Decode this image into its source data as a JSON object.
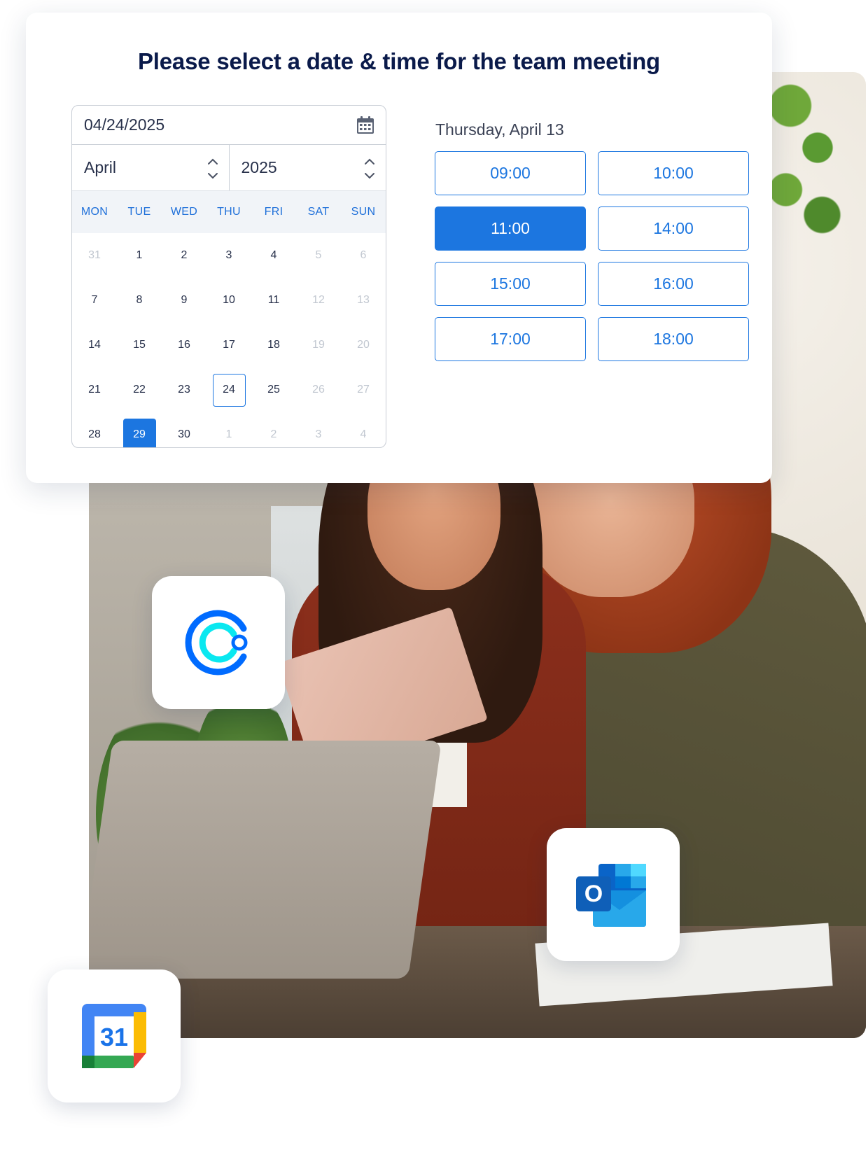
{
  "card": {
    "title": "Please select a date & time for the team meeting"
  },
  "picker": {
    "date_value": "04/24/2025",
    "month": "April",
    "year": "2025",
    "weekdays": [
      "MON",
      "TUE",
      "WED",
      "THU",
      "FRI",
      "SAT",
      "SUN"
    ],
    "days": [
      {
        "label": "31",
        "state": "muted"
      },
      {
        "label": "1",
        "state": "normal"
      },
      {
        "label": "2",
        "state": "normal"
      },
      {
        "label": "3",
        "state": "normal"
      },
      {
        "label": "4",
        "state": "normal"
      },
      {
        "label": "5",
        "state": "muted"
      },
      {
        "label": "6",
        "state": "muted"
      },
      {
        "label": "7",
        "state": "normal"
      },
      {
        "label": "8",
        "state": "normal"
      },
      {
        "label": "9",
        "state": "normal"
      },
      {
        "label": "10",
        "state": "normal"
      },
      {
        "label": "11",
        "state": "normal"
      },
      {
        "label": "12",
        "state": "muted"
      },
      {
        "label": "13",
        "state": "muted"
      },
      {
        "label": "14",
        "state": "normal"
      },
      {
        "label": "15",
        "state": "normal"
      },
      {
        "label": "16",
        "state": "normal"
      },
      {
        "label": "17",
        "state": "normal"
      },
      {
        "label": "18",
        "state": "normal"
      },
      {
        "label": "19",
        "state": "muted"
      },
      {
        "label": "20",
        "state": "muted"
      },
      {
        "label": "21",
        "state": "normal"
      },
      {
        "label": "22",
        "state": "normal"
      },
      {
        "label": "23",
        "state": "normal"
      },
      {
        "label": "24",
        "state": "today"
      },
      {
        "label": "25",
        "state": "normal"
      },
      {
        "label": "26",
        "state": "muted"
      },
      {
        "label": "27",
        "state": "muted"
      },
      {
        "label": "28",
        "state": "normal"
      },
      {
        "label": "29",
        "state": "selected"
      },
      {
        "label": "30",
        "state": "normal"
      },
      {
        "label": "1",
        "state": "muted"
      },
      {
        "label": "2",
        "state": "muted"
      },
      {
        "label": "3",
        "state": "muted"
      },
      {
        "label": "4",
        "state": "muted"
      }
    ]
  },
  "slots": {
    "date_label": "Thursday, April 13",
    "times": [
      {
        "label": "09:00",
        "active": false
      },
      {
        "label": "10:00",
        "active": false
      },
      {
        "label": "11:00",
        "active": true
      },
      {
        "label": "14:00",
        "active": false
      },
      {
        "label": "15:00",
        "active": false
      },
      {
        "label": "16:00",
        "active": false
      },
      {
        "label": "17:00",
        "active": false
      },
      {
        "label": "18:00",
        "active": false
      }
    ]
  },
  "apps": [
    {
      "name": "calendly-logo-icon"
    },
    {
      "name": "outlook-logo-icon",
      "letter": "O"
    },
    {
      "name": "google-calendar-logo-icon",
      "number": "31"
    }
  ],
  "colors": {
    "accent": "#1c76e0",
    "title": "#0a1a4a",
    "muted_day": "#c1c7d0"
  }
}
